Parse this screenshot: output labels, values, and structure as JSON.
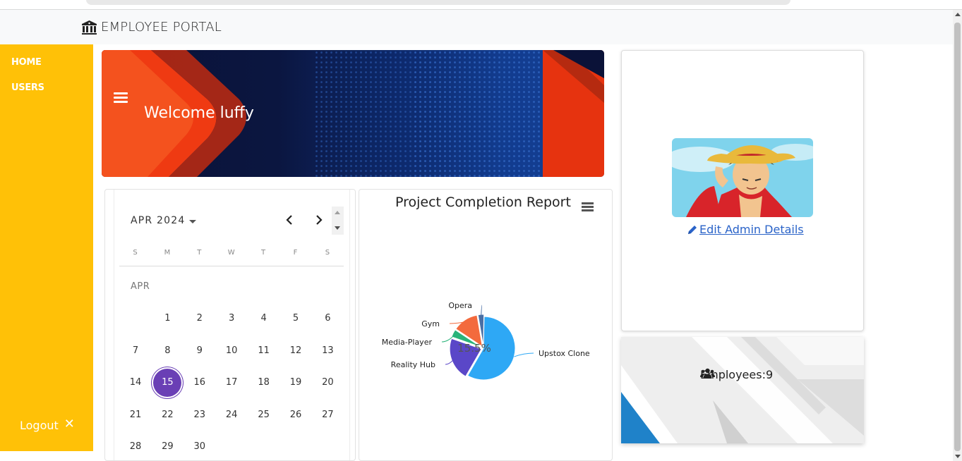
{
  "brand": {
    "title": "EMPLOYEE PORTAL",
    "icon": "building-icon"
  },
  "sidebar": {
    "items": [
      {
        "label": "HOME"
      },
      {
        "label": "USERS"
      }
    ],
    "logout_label": "Logout",
    "logout_icon": "close-icon",
    "color": "#ffc107"
  },
  "banner": {
    "welcome": "Welcome luffy"
  },
  "calendar": {
    "month_label": "APR 2024",
    "section_label": "APR",
    "weekdays": [
      "S",
      "M",
      "T",
      "W",
      "T",
      "F",
      "S"
    ],
    "days": [
      "1",
      "2",
      "3",
      "4",
      "5",
      "6",
      "7",
      "8",
      "9",
      "10",
      "11",
      "12",
      "13",
      "14",
      "15",
      "16",
      "17",
      "18",
      "19",
      "20",
      "21",
      "22",
      "23",
      "24",
      "25",
      "26",
      "27",
      "28",
      "29",
      "30"
    ],
    "first_weekday_index": 1,
    "selected_day": "15",
    "accent": "#6a3fb5"
  },
  "chart": {
    "title": "Project Completion Report",
    "center_label": "15.5%"
  },
  "chart_data": {
    "type": "pie",
    "title": "Project Completion Report",
    "labels": [
      "Upstox Clone",
      "Reality Hub",
      "Media-Player",
      "Gym",
      "Opera"
    ],
    "values": [
      58,
      22,
      4,
      13,
      3
    ],
    "colors": [
      "#2ea8f5",
      "#5a47c8",
      "#29b37a",
      "#f36a3d",
      "#4a6fa5"
    ]
  },
  "admin": {
    "edit_label": "Edit Admin Details",
    "edit_icon": "pencil-icon",
    "link_color": "#2a63c8"
  },
  "employees": {
    "label": "Employees:9",
    "icon": "users-icon"
  }
}
